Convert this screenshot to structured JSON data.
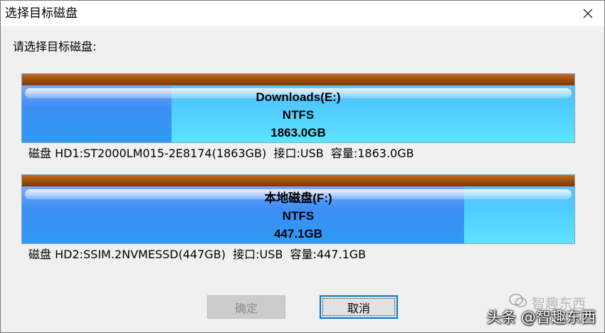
{
  "window": {
    "title": "选择目标磁盘",
    "close_icon": "close-icon"
  },
  "prompt": "请选择目标磁盘:",
  "disks": [
    {
      "volume_label": "Downloads(E:)",
      "filesystem": "NTFS",
      "size": "1863.0GB",
      "used_fraction": 0.27,
      "info": "磁盘 HD1:ST2000LM015-2E8174(1863GB)  接口:USB  容量:1863.0GB"
    },
    {
      "volume_label": "本地磁盘(F:)",
      "filesystem": "NTFS",
      "size": "447.1GB",
      "used_fraction": 0.8,
      "info": "磁盘 HD2:SSIM.2NVMESSD(447GB)  接口:USB  容量:447.1GB"
    }
  ],
  "buttons": {
    "ok_label": "确定",
    "ok_enabled": false,
    "cancel_label": "取消"
  },
  "watermark": {
    "text": "头条 @智趣东西",
    "ghost_text": "智趣东西"
  },
  "colors": {
    "disk_cap": "#9a4c0c",
    "disk_free": "#4fc9ff",
    "disk_used": "#3c8ef5",
    "focus_border": "#0078d7"
  }
}
